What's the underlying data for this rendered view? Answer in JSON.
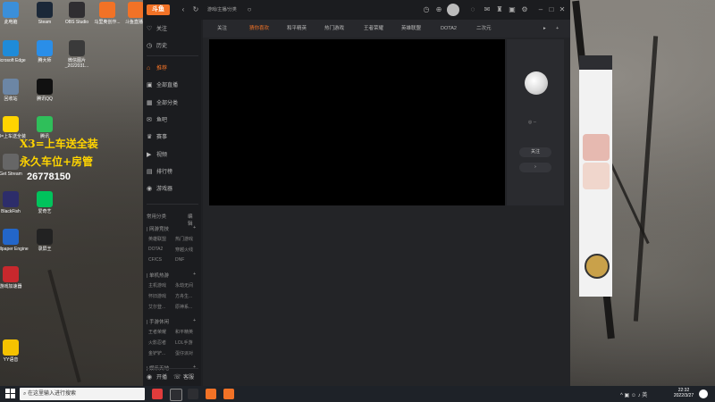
{
  "desktop": {
    "icons": [
      {
        "label": "此电脑",
        "color": "#3b8fd9"
      },
      {
        "label": "Steam",
        "color": "#1b2838"
      },
      {
        "label": "OBS Studio",
        "color": "#302e31"
      },
      {
        "label": "马里奥创作...",
        "color": "#f27226"
      },
      {
        "label": "斗鱼直播...",
        "color": "#f27226"
      },
      {
        "label": "Microsoft Edge",
        "color": "#1f8bd8"
      },
      {
        "label": "腾大师",
        "color": "#2a8ee8"
      },
      {
        "label": "微信图片_2022031...",
        "color": "#3a3a3a"
      },
      {
        "label": "回收站",
        "color": "#6c86a5"
      },
      {
        "label": "腾讯QQ",
        "color": "#111111"
      },
      {
        "label": "X3=上车送全装",
        "color": "#ffd400"
      },
      {
        "label": "腾讯",
        "color": "#2fbf5a"
      },
      {
        "label": "Get Stream",
        "color": "#666666"
      },
      {
        "label": "BlackFish",
        "color": "#2d2d6a"
      },
      {
        "label": "爱奇艺",
        "color": "#00c35c"
      },
      {
        "label": "Wallpaper Engine",
        "color": "#2366c9"
      },
      {
        "label": "录屏王",
        "color": "#222222"
      },
      {
        "label": "游戏加速器",
        "color": "#c8282d"
      },
      {
        "label": "YY语音",
        "color": "#f5c200"
      }
    ],
    "promo_lines": [
      "X3=上车送全装",
      "永久车位+房管",
      "26778150"
    ]
  },
  "app": {
    "logo_text": "斗鱼",
    "url": "游戏/主播/分类",
    "sidebar_top": [
      {
        "label": "关注",
        "icon": "♡"
      },
      {
        "label": "历史",
        "icon": "◷"
      }
    ],
    "sidebar_nav": [
      {
        "label": "推荐",
        "icon": "⌂"
      },
      {
        "label": "全部直播",
        "icon": "▣"
      },
      {
        "label": "全部分类",
        "icon": "▦"
      },
      {
        "label": "鱼吧",
        "icon": "✉"
      },
      {
        "label": "赛事",
        "icon": "♛"
      },
      {
        "label": "视频",
        "icon": "▶"
      },
      {
        "label": "排行榜",
        "icon": "▤"
      },
      {
        "label": "游戏器",
        "icon": "◉"
      }
    ],
    "common_category": {
      "label": "常用分类",
      "action": "编辑"
    },
    "sections": [
      {
        "title": "网游竞技",
        "items": [
          "英雄联盟",
          "热门游戏",
          "DOTA2",
          "穿越火线",
          "CF/CS",
          "DNF"
        ]
      },
      {
        "title": "单机热游",
        "items": [
          "主机游戏",
          "永劫无间",
          "怀旧游戏",
          "方舟生...",
          "艾尔登...",
          "原神系..."
        ]
      },
      {
        "title": "手游休闲",
        "items": [
          "王者荣耀",
          "和平精英",
          "火影忍者",
          "LOL手游",
          "金铲铲...",
          "蛋仔派对"
        ]
      },
      {
        "title": "娱乐天地",
        "items": []
      }
    ],
    "bottom": [
      {
        "label": "开播",
        "icon": "◉"
      },
      {
        "label": "客服",
        "icon": "☏"
      }
    ],
    "tabs": [
      "关注",
      "猜你喜欢",
      "和平精英",
      "热门游戏",
      "王者荣耀",
      "英雄联盟",
      "DOTA2",
      "二次元"
    ],
    "active_tab": 1,
    "right_panel": {
      "status": "◎ --",
      "follow": "关注",
      "arrow": "›"
    }
  },
  "taskbar": {
    "search_placeholder": "在这里输入进行搜索",
    "time": "22:32",
    "date": "2022/3/27",
    "tray": "^ ▣ ☺ ♪ 英"
  },
  "colors": {
    "accent": "#f27226",
    "app_bg": "#1f2023",
    "video_bg": "#000000"
  }
}
